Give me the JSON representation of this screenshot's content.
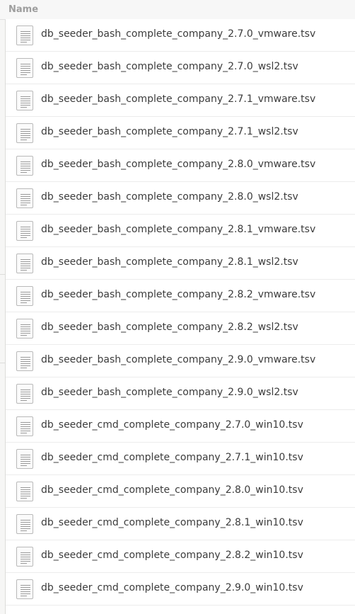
{
  "header": {
    "name_label": "Name"
  },
  "files": [
    "db_seeder_bash_complete_company_2.7.0_vmware.tsv",
    "db_seeder_bash_complete_company_2.7.0_wsl2.tsv",
    "db_seeder_bash_complete_company_2.7.1_vmware.tsv",
    "db_seeder_bash_complete_company_2.7.1_wsl2.tsv",
    "db_seeder_bash_complete_company_2.8.0_vmware.tsv",
    "db_seeder_bash_complete_company_2.8.0_wsl2.tsv",
    "db_seeder_bash_complete_company_2.8.1_vmware.tsv",
    "db_seeder_bash_complete_company_2.8.1_wsl2.tsv",
    "db_seeder_bash_complete_company_2.8.2_vmware.tsv",
    "db_seeder_bash_complete_company_2.8.2_wsl2.tsv",
    "db_seeder_bash_complete_company_2.9.0_vmware.tsv",
    "db_seeder_bash_complete_company_2.9.0_wsl2.tsv",
    "db_seeder_cmd_complete_company_2.7.0_win10.tsv",
    "db_seeder_cmd_complete_company_2.7.1_win10.tsv",
    "db_seeder_cmd_complete_company_2.8.0_win10.tsv",
    "db_seeder_cmd_complete_company_2.8.1_win10.tsv",
    "db_seeder_cmd_complete_company_2.8.2_win10.tsv",
    "db_seeder_cmd_complete_company_2.9.0_win10.tsv"
  ],
  "icon": "text-file-icon"
}
